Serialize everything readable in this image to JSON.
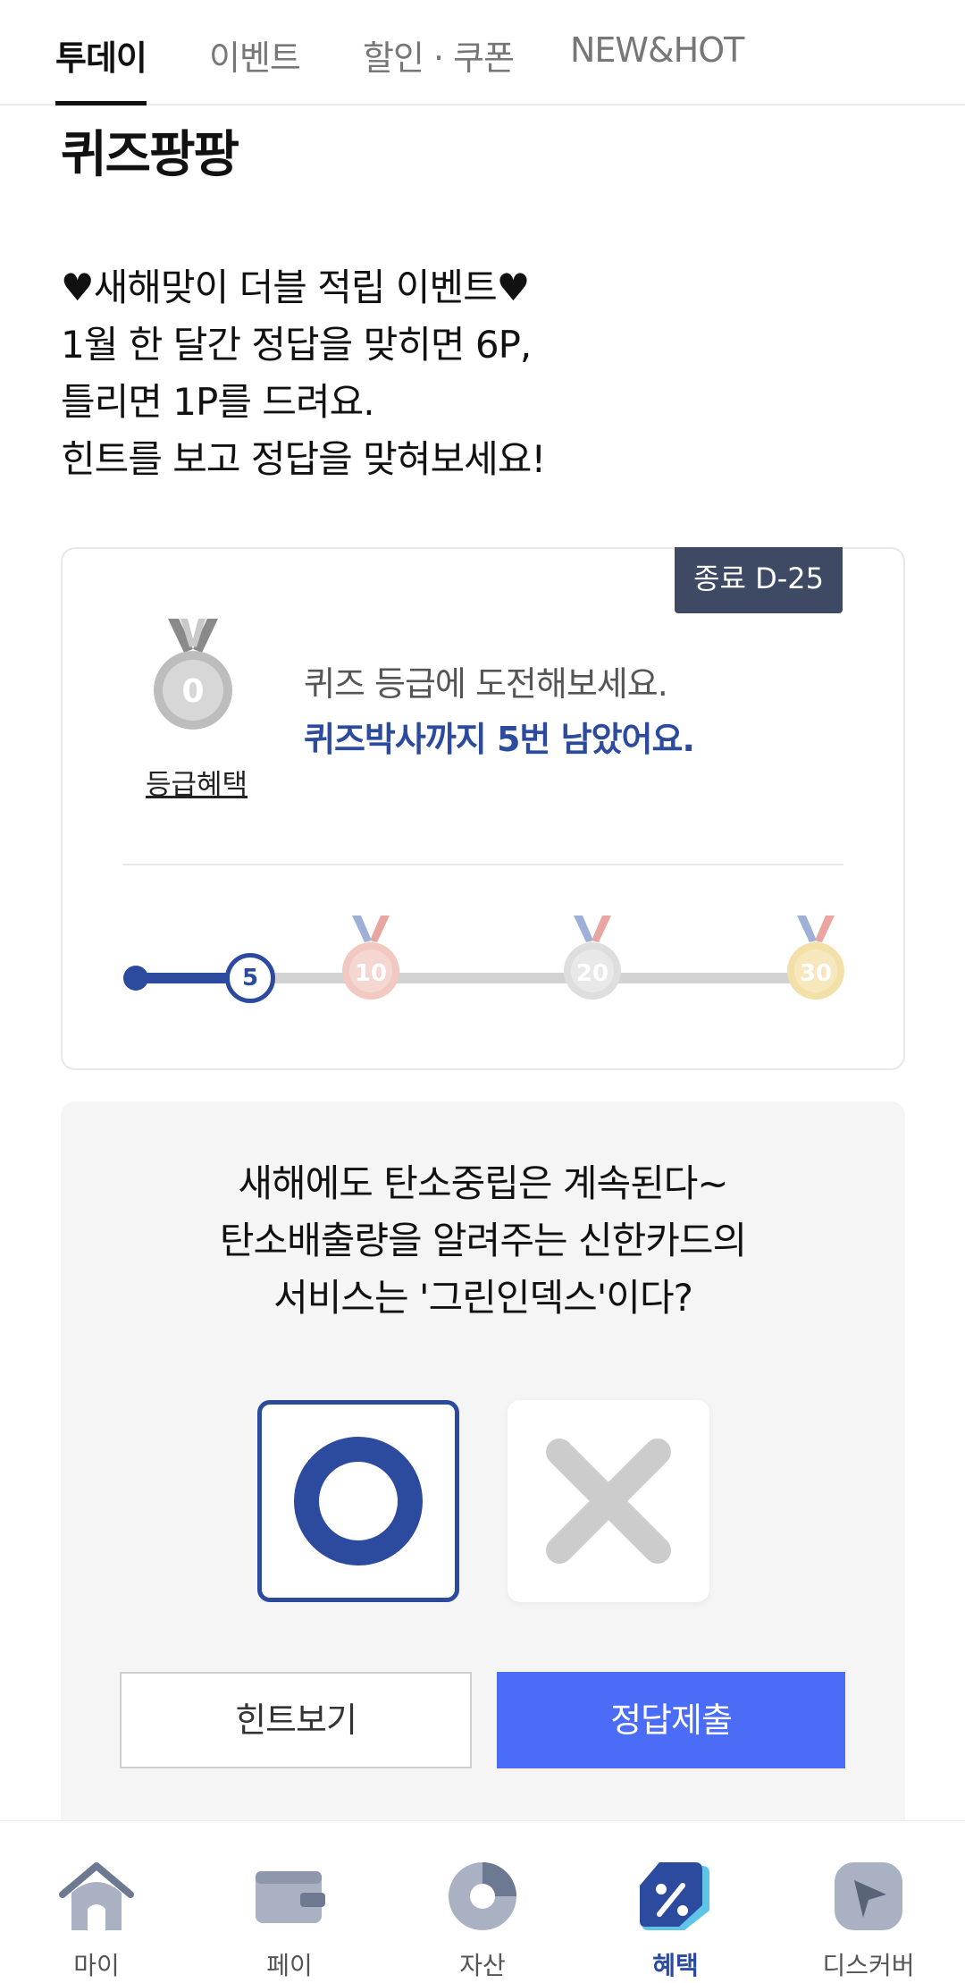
{
  "tabs": [
    {
      "label": "투데이"
    },
    {
      "label": "이벤트"
    },
    {
      "label": "할인 · 쿠폰"
    },
    {
      "label": "NEW&HOT"
    }
  ],
  "page_title": "퀴즈팡팡",
  "description": [
    "♥새해맞이 더블 적립 이벤트♥",
    "1월 한 달간 정답을 맞히면 6P,",
    "틀리면 1P를 드려요.",
    "힌트를 보고 정답을 맞혀보세요!"
  ],
  "grade": {
    "dday": "종료 D-25",
    "medal_number": "0",
    "benefit_link": "등급혜택",
    "challenge_text": "퀴즈 등급에 도전해보세요.",
    "remaining_text": "퀴즈박사까지 5번 남았어요.",
    "progress": {
      "current": "5",
      "milestones": [
        "10",
        "20",
        "30"
      ]
    }
  },
  "quiz": {
    "question": [
      "새해에도 탄소중립은 계속된다~",
      "탄소배출량을 알려주는 신한카드의",
      "서비스는 '그린인덱스'이다?"
    ],
    "hint_button": "힌트보기",
    "submit_button": "정답제출"
  },
  "bottom_nav": [
    {
      "label": "마이",
      "icon": "home-icon"
    },
    {
      "label": "페이",
      "icon": "wallet-icon"
    },
    {
      "label": "자산",
      "icon": "pie-chart-icon"
    },
    {
      "label": "혜택",
      "icon": "percent-tag-icon"
    },
    {
      "label": "디스커버",
      "icon": "compass-icon"
    }
  ],
  "colors": {
    "accent_navy": "#2c4a9e",
    "submit_blue": "#4a6cf7",
    "dday_bg": "#3e4a63"
  }
}
